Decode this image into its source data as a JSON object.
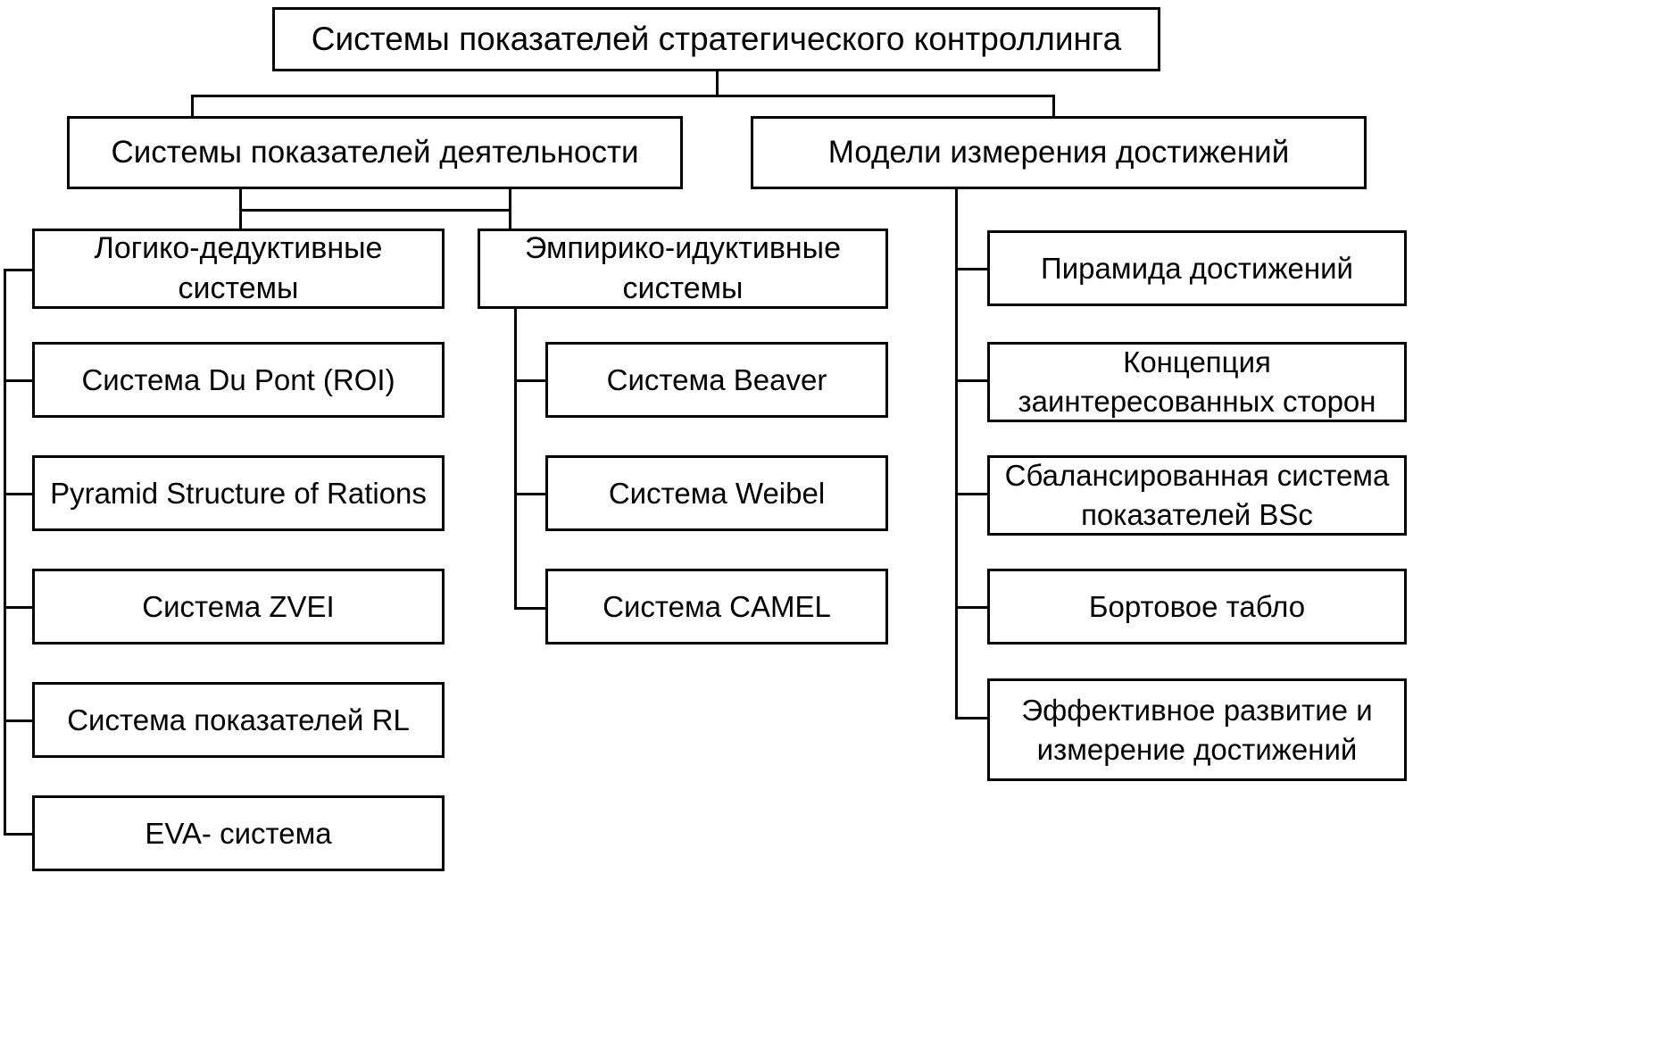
{
  "diagram": {
    "type": "hierarchical-tree",
    "title_node": {
      "id": "root",
      "label": "Системы показателей стратегического контроллинга"
    },
    "level2": [
      {
        "id": "l2-performance",
        "label": "Системы показателей деятельности"
      },
      {
        "id": "l2-achievement",
        "label": "Модели измерения достижений"
      }
    ],
    "level3": [
      {
        "id": "l3-logical",
        "label": "Логико-дедуктивные\nсистемы"
      },
      {
        "id": "l3-empirical",
        "label": "Эмпирико-идуктивные\nсистемы"
      }
    ],
    "logical_children": [
      {
        "id": "leaf-dupont",
        "label": "Система Du Pont    (ROI)"
      },
      {
        "id": "leaf-pyramid",
        "label": "Pyramid Structure of Rations"
      },
      {
        "id": "leaf-zvei",
        "label": "Система ZVEI"
      },
      {
        "id": "leaf-rl",
        "label": "Система показателей RL"
      },
      {
        "id": "leaf-eva",
        "label": "EVA- система"
      }
    ],
    "empirical_children": [
      {
        "id": "leaf-beaver",
        "label": "Система Beaver"
      },
      {
        "id": "leaf-weibel",
        "label": "Система Weibel"
      },
      {
        "id": "leaf-camel",
        "label": "Система CAMEL"
      }
    ],
    "achievement_children": [
      {
        "id": "leaf-pyramid-ach",
        "label": "Пирамида достижений"
      },
      {
        "id": "leaf-stakeholder",
        "label": "Концепция\nзаинтересованных сторон"
      },
      {
        "id": "leaf-bsc",
        "label": "Сбалансированная система\nпоказателей BSc"
      },
      {
        "id": "leaf-dashboard",
        "label": "Бортовое табло"
      },
      {
        "id": "leaf-effective",
        "label": "Эффективное развитие и\nизмерение достижений"
      }
    ],
    "colors": {
      "stroke": "#000000",
      "fill": "#ffffff",
      "text": "#000000"
    }
  }
}
